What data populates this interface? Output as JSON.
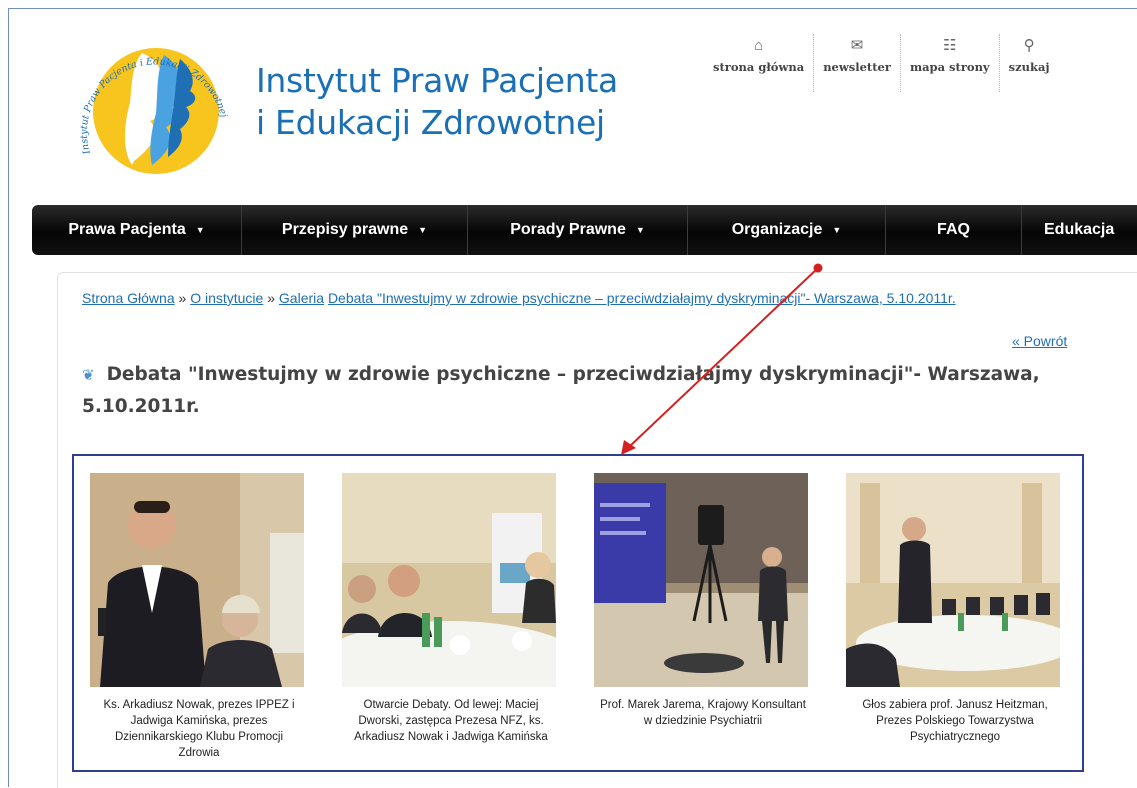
{
  "site": {
    "title_line1": "Instytut Praw Pacjenta",
    "title_line2": "i Edukacji Zdrowotnej",
    "logo_text": "Instytut Praw Pacjenta i Edukacji Zdrowotnej"
  },
  "toplinks": [
    {
      "label": "strona główna",
      "icon": "home-icon"
    },
    {
      "label": "newsletter",
      "icon": "newsletter-icon"
    },
    {
      "label": "mapa strony",
      "icon": "sitemap-icon"
    },
    {
      "label": "szukaj",
      "icon": "search-icon"
    }
  ],
  "nav": [
    {
      "label": "Prawa Pacjenta",
      "caret": "▼"
    },
    {
      "label": "Przepisy prawne",
      "caret": "▼"
    },
    {
      "label": "Porady Prawne",
      "caret": "▼"
    },
    {
      "label": "Organizacje",
      "caret": "▼"
    },
    {
      "label": "FAQ",
      "caret": ""
    },
    {
      "label": "Edukacja",
      "caret": ""
    }
  ],
  "breadcrumb": {
    "home": "Strona Główna",
    "sep": " » ",
    "about": "O instytucie",
    "gallery": "Galeria",
    "current": "Debata \"Inwestujmy w zdrowie psychiczne – przeciwdziałajmy dyskryminacji\"- Warszawa, 5.10.2011r."
  },
  "back_link": "« Powrót",
  "page_title": "Debata \"Inwestujmy w zdrowie psychiczne – przeciwdziałajmy dyskryminacji\"- Warszawa, 5.10.2011r.",
  "gallery": [
    {
      "caption": "Ks. Arkadiusz Nowak, prezes IPPEZ i Jadwiga Kamińska, prezes Dziennikarskiego Klubu Promocji Zdrowia"
    },
    {
      "caption": "Otwarcie Debaty. Od lewej: Maciej Dworski, zastępca Prezesa NFZ, ks. Arkadiusz Nowak i Jadwiga Kamińska"
    },
    {
      "caption": "Prof. Marek Jarema, Krajowy Konsultant w dziedzinie Psychiatrii"
    },
    {
      "caption": "Głos zabiera prof. Janusz Heitzman, Prezes Polskiego Towarzystwa Psychiatrycznego"
    }
  ],
  "colors": {
    "title_blue": "#1a6fb5",
    "link_blue": "#1f6fb2",
    "nav_bg": "#0b0b0b",
    "gallery_border": "#2e3d8c",
    "annotation_red": "#d42020"
  }
}
